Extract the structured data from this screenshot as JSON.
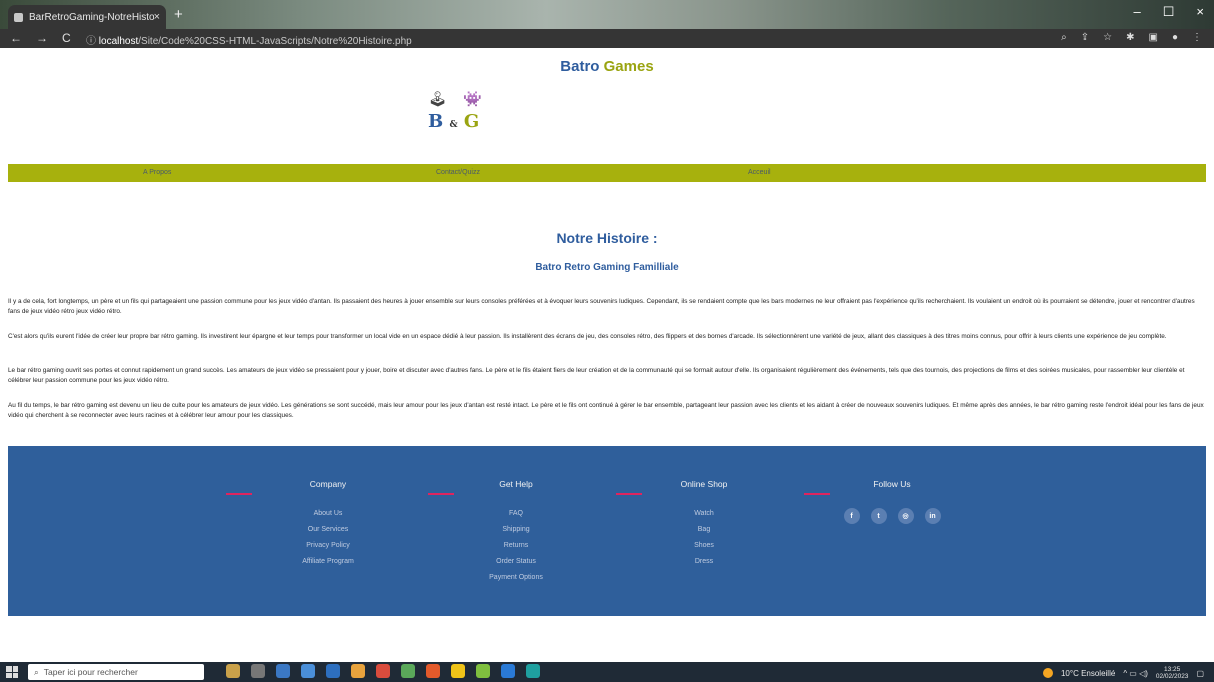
{
  "browser": {
    "tab_title": "BarRetroGaming-NotreHistoire",
    "tab_close": "×",
    "new_tab": "+",
    "url_host": "localhost",
    "url_path": "/Site/Code%20CSS-HTML-JavaScripts/Notre%20Histoire.php",
    "back": "←",
    "forward": "→",
    "reload": "C",
    "info": "ⓘ",
    "controls": {
      "minimize": "–",
      "maximize": "☐",
      "close": "×"
    }
  },
  "site": {
    "brand_part1": "Batro ",
    "brand_part2": "Games",
    "logo": {
      "b": "B",
      "amp": "&",
      "g": "G",
      "icons": "🕹 👾"
    },
    "nav": [
      {
        "label": "A Propos"
      },
      {
        "label": "Contact/Quizz"
      },
      {
        "label": "Acceuil"
      }
    ]
  },
  "content": {
    "title": "Notre Histoire :",
    "subtitle": "Batro Retro Gaming Familliale",
    "paragraphs": [
      "Il y a de cela, fort longtemps, un père et un fils qui partageaient une passion commune pour les jeux vidéo d'antan. Ils passaient des heures à jouer ensemble sur leurs consoles préférées et à évoquer leurs souvenirs ludiques. Cependant, ils se rendaient compte que les bars modernes ne leur offraient pas l'expérience qu'ils recherchaient. Ils voulaient un endroit où ils pourraient se détendre, jouer et rencontrer d'autres fans de jeux vidéo rétro jeux vidéo rétro.",
      "C'est alors qu'ils eurent l'idée de créer leur propre bar rétro gaming. Ils investirent leur épargne et leur temps pour transformer un local vide en un espace dédié à leur passion. Ils installèrent des écrans de jeu, des consoles rétro, des flippers et des bornes d'arcade. Ils sélectionnèrent une variété de jeux, allant des classiques à des titres moins connus, pour offrir à leurs clients une expérience de jeu complète.",
      "Le bar rétro gaming ouvrit ses portes et connut rapidement un grand succès. Les amateurs de jeux vidéo se pressaient pour y jouer, boire et discuter avec d'autres fans. Le père et le fils étaient fiers de leur création et de la communauté qui se formait autour d'elle. Ils organisaient régulièrement des événements, tels que des tournois, des projections de films et des soirées musicales, pour rassembler leur clientèle et célébrer leur passion commune pour les jeux vidéo rétro.",
      "Au fil du temps, le bar rétro gaming est devenu un lieu de culte pour les amateurs de jeux vidéo. Les générations se sont succédé, mais leur amour pour les jeux d'antan est resté intact. Le père et le fils ont continué à gérer le bar ensemble, partageant leur passion avec les clients et les aidant à créer de nouveaux souvenirs ludiques. Et même après des années, le bar rétro gaming reste l'endroit idéal pour les fans de jeux vidéo qui cherchent à se reconnecter avec leurs racines et à célébrer leur amour pour les classiques."
    ]
  },
  "footer": {
    "company": {
      "title": "Company",
      "links": [
        "About Us",
        "Our Services",
        "Privacy Policy",
        "Affiliate Program"
      ]
    },
    "help": {
      "title": "Get Help",
      "links": [
        "FAQ",
        "Shipping",
        "Returns",
        "Order Status",
        "Payment Options"
      ]
    },
    "shop": {
      "title": "Online Shop",
      "links": [
        "Watch",
        "Bag",
        "Shoes",
        "Dress"
      ]
    },
    "follow": {
      "title": "Follow Us",
      "icons": [
        "f",
        "t",
        "◎",
        "in"
      ]
    }
  },
  "taskbar": {
    "search_placeholder": "Taper ici pour rechercher",
    "weather": "10°C Ensoleillé",
    "time": "13:25",
    "date": "02/02/2023"
  },
  "colors": {
    "brand_blue": "#2f5d9e",
    "brand_green": "#9aa411",
    "nav_bg": "#a7b10d",
    "footer_bg": "#2f5f9b",
    "accent_pink": "#e0245e"
  }
}
